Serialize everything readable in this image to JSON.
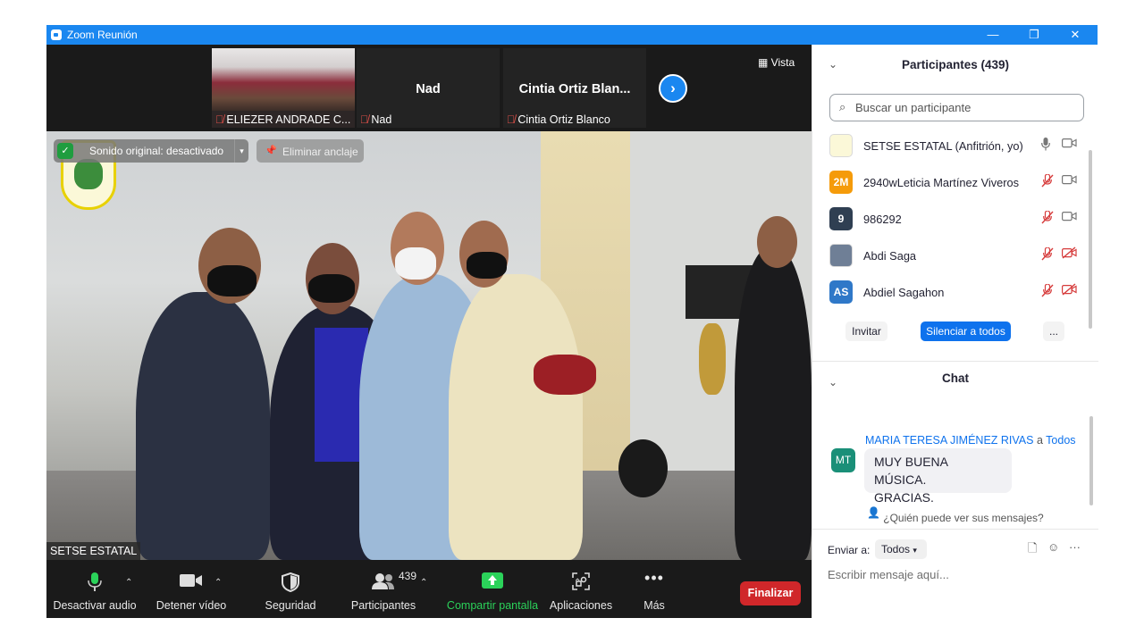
{
  "window": {
    "title": "Zoom Reunión",
    "minimize": "—",
    "restore": "❐",
    "close": "✕"
  },
  "strip": {
    "tiles": [
      {
        "name": "ELIEZER ANDRADE C..."
      },
      {
        "big_name": "Nad",
        "name": "Nad"
      },
      {
        "big_name": "Cintia  Ortiz  Blan...",
        "name": "Cintia Ortiz Blanco"
      }
    ],
    "next_icon": "›",
    "view_label": "Vista"
  },
  "main_video": {
    "sound_label": "Sonido original: desactivado",
    "unpin_label": "Eliminar anclaje",
    "speaker_name": "SETSE ESTATAL"
  },
  "toolbar": {
    "audio_label": "Desactivar audio",
    "video_label": "Detener vídeo",
    "security_label": "Seguridad",
    "participants_label": "Participantes",
    "participants_count": "439",
    "share_label": "Compartir pantalla",
    "apps_label": "Aplicaciones",
    "more_label": "Más",
    "end_label": "Finalizar"
  },
  "participants_panel": {
    "title": "Participantes (439)",
    "search_placeholder": "Buscar un participante",
    "rows": [
      {
        "initials": "",
        "name": "SETSE ESTATAL (Anfitrión, yo)",
        "avatar_color": "#fbf8d8",
        "mic": "on",
        "cam": "on"
      },
      {
        "initials": "2M",
        "name": "2940wLeticia Martínez Viveros",
        "avatar_color": "#f59b0a",
        "mic": "off",
        "cam": "on"
      },
      {
        "initials": "9",
        "name": "986292",
        "avatar_color": "#2f3f52",
        "mic": "off",
        "cam": "on"
      },
      {
        "initials": "",
        "name": "Abdi Saga",
        "avatar_color": "#6f7f96",
        "mic": "off",
        "cam": "off"
      },
      {
        "initials": "AS",
        "name": "Abdiel Sagahon",
        "avatar_color": "#2f78c8",
        "mic": "off",
        "cam": "off"
      }
    ],
    "invite_label": "Invitar",
    "mute_all_label": "Silenciar a todos",
    "more_label": "..."
  },
  "chat_panel": {
    "title": "Chat",
    "message": {
      "sender": "MARIA TERESA JIMÉNEZ RIVAS",
      "to_word": "a",
      "recipient": "Todos",
      "initials": "MT",
      "line1": "MUY BUENA MÚSICA.",
      "line2": "GRACIAS."
    },
    "who_sees": "¿Quién puede ver sus mensajes?",
    "send_to_label": "Enviar a:",
    "send_to_value": "Todos",
    "input_placeholder": "Escribir mensaje aquí..."
  },
  "colors": {
    "titlebar": "#1a87f0",
    "accent": "#0e72ed",
    "end": "#d0272a",
    "share": "#2bd25a"
  }
}
